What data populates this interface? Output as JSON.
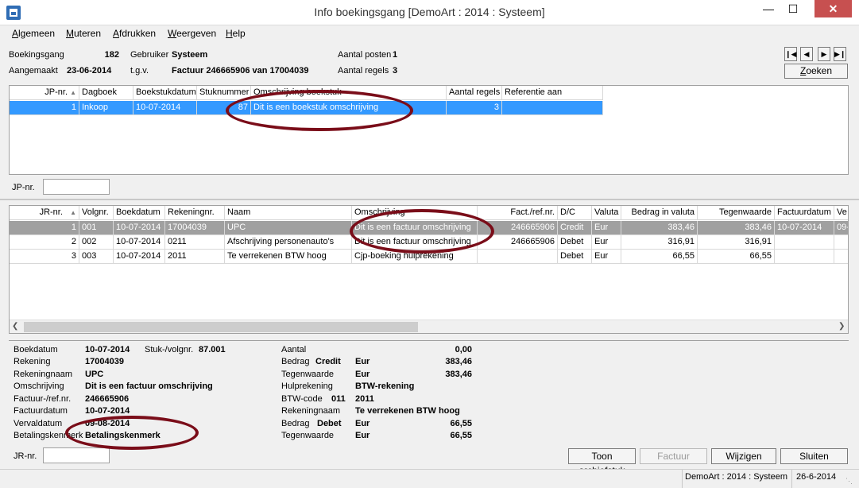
{
  "window": {
    "title": "Info boekingsgang  [DemoArt : 2014 : Systeem]"
  },
  "menu": {
    "items": [
      {
        "label": "Algemeen"
      },
      {
        "label": "Muteren"
      },
      {
        "label": "Afdrukken"
      },
      {
        "label": "Weergeven"
      },
      {
        "label": "Help"
      }
    ]
  },
  "header": {
    "boekingsgang_label": "Boekingsgang",
    "boekingsgang_value": "182",
    "gebruiker_label": "Gebruiker",
    "gebruiker_value": "Systeem",
    "aangemaakt_label": "Aangemaakt",
    "aangemaakt_value": "23-06-2014",
    "tgv_label": "t.g.v.",
    "tgv_value": "Factuur 246665906 van 17004039",
    "aantal_posten_label": "Aantal posten",
    "aantal_posten_value": "1",
    "aantal_regels_label": "Aantal regels",
    "aantal_regels_value": "3",
    "search_button": "Zoeken",
    "nav": {
      "first_icon": "first-record-icon",
      "prev_icon": "prev-record-icon",
      "next_icon": "next-record-icon",
      "last_icon": "last-record-icon"
    }
  },
  "jp_grid": {
    "columns": [
      "JP-nr.",
      "Dagboek",
      "Boekstukdatum",
      "Stuknummer",
      "Omschrijving boekstuk",
      "Aantal regels",
      "Referentie aan"
    ],
    "rows": [
      [
        "1",
        "Inkoop",
        "10-07-2014",
        "87",
        "Dit is een boekstuk omschrijving",
        "3",
        ""
      ]
    ]
  },
  "jp_filter": {
    "label": "JP-nr.",
    "value": ""
  },
  "jr_grid": {
    "columns": [
      "JR-nr.",
      "Volgnr.",
      "Boekdatum",
      "Rekeningnr.",
      "Naam",
      "Omschrijving",
      "Fact./ref.nr.",
      "D/C",
      "Valuta",
      "Bedrag in valuta",
      "Tegenwaarde",
      "Factuurdatum",
      "Ve"
    ],
    "rows": [
      [
        "1",
        "001",
        "10-07-2014",
        "17004039",
        "UPC",
        "Dit is een factuur omschrijving",
        "246665906",
        "Credit",
        "Eur",
        "383,46",
        "383,46",
        "10-07-2014",
        "09-"
      ],
      [
        "2",
        "002",
        "10-07-2014",
        "0211",
        "Afschrijving personenauto's",
        "Dit is een factuur omschrijving",
        "246665906",
        "Debet",
        "Eur",
        "316,91",
        "316,91",
        "",
        ""
      ],
      [
        "3",
        "003",
        "10-07-2014",
        "2011",
        "Te verrekenen BTW hoog",
        "Cjp-boeking hulprekening",
        "",
        "Debet",
        "Eur",
        "66,55",
        "66,55",
        "",
        ""
      ]
    ]
  },
  "details": {
    "boekdatum_label": "Boekdatum",
    "boekdatum_value": "10-07-2014",
    "stuk_label": "Stuk-/volgnr.",
    "stuk_value": "87.001",
    "rekening_label": "Rekening",
    "rekening_value": "17004039",
    "rekeningnaam_label": "Rekeningnaam",
    "rekeningnaam_value": "UPC",
    "omschrijving_label": "Omschrijving",
    "omschrijving_value": "Dit is een factuur omschrijving",
    "factuur_label": "Factuur-/ref.nr.",
    "factuur_value": "246665906",
    "factuurdatum_label": "Factuurdatum",
    "factuurdatum_value": "10-07-2014",
    "vervaldatum_label": "Vervaldatum",
    "vervaldatum_value": "09-08-2014",
    "betalingskenmerk_label": "Betalingskenmerk",
    "betalingskenmerk_value": "Betalingskenmerk",
    "aantal_label": "Aantal",
    "aantal_value": "0,00",
    "bedrag1_label": "Bedrag",
    "bedrag1_dc": "Credit",
    "bedrag1_cur": "Eur",
    "bedrag1_value": "383,46",
    "tegenwaarde1_label": "Tegenwaarde",
    "tegenwaarde1_cur": "Eur",
    "tegenwaarde1_value": "383,46",
    "hulprekening_label": "Hulprekening",
    "hulprekening_value": "BTW-rekening",
    "btwcode_label": "BTW-code",
    "btwcode_code": "011",
    "btwcode_value": "2011",
    "rekeningnaam2_label": "Rekeningnaam",
    "rekeningnaam2_value": "Te verrekenen BTW hoog",
    "bedrag2_label": "Bedrag",
    "bedrag2_dc": "Debet",
    "bedrag2_cur": "Eur",
    "bedrag2_value": "66,55",
    "tegenwaarde2_label": "Tegenwaarde",
    "tegenwaarde2_cur": "Eur",
    "tegenwaarde2_value": "66,55"
  },
  "jr_filter": {
    "label": "JR-nr.",
    "value": ""
  },
  "buttons": {
    "archive": "Toon archiefstuk",
    "invoice": "Factuur",
    "edit": "Wijzigen",
    "close": "Sluiten"
  },
  "status": {
    "context": "DemoArt : 2014 : Systeem",
    "date": "26-6-2014"
  },
  "colors": {
    "selection_blue": "#3399ff",
    "selection_gray": "#a0a0a0",
    "annotation": "#7a0d19"
  }
}
